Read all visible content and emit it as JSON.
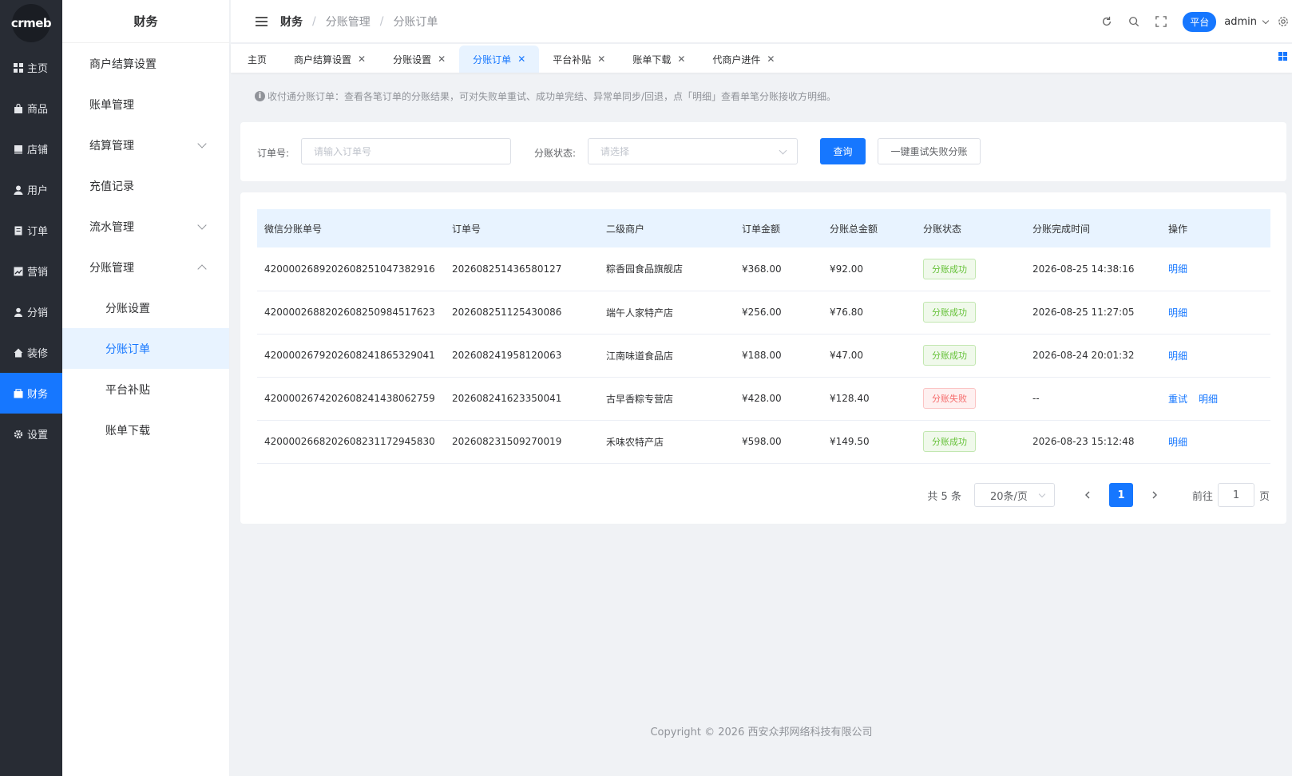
{
  "brand": {
    "logo_text": "crmeb"
  },
  "rail": [
    {
      "label": "主页",
      "icon": "grid-icon",
      "active": false
    },
    {
      "label": "商品",
      "icon": "bag-icon",
      "active": false
    },
    {
      "label": "店铺",
      "icon": "store-icon",
      "active": false
    },
    {
      "label": "用户",
      "icon": "user-icon",
      "active": false
    },
    {
      "label": "订单",
      "icon": "order-icon",
      "active": false
    },
    {
      "label": "营销",
      "icon": "chart-icon",
      "active": false
    },
    {
      "label": "分销",
      "icon": "distribution-icon",
      "active": false
    },
    {
      "label": "装修",
      "icon": "home-icon",
      "active": false
    },
    {
      "label": "财务",
      "icon": "finance-icon",
      "active": true
    },
    {
      "label": "设置",
      "icon": "gear-icon",
      "active": false
    }
  ],
  "sub_menu": {
    "title": "财务",
    "items": [
      {
        "label": "商户结算设置",
        "chevron": "",
        "child": false,
        "active": false
      },
      {
        "label": "账单管理",
        "chevron": "",
        "child": false,
        "active": false
      },
      {
        "label": "结算管理",
        "chevron": "down",
        "child": false,
        "active": false
      },
      {
        "label": "充值记录",
        "chevron": "",
        "child": false,
        "active": false
      },
      {
        "label": "流水管理",
        "chevron": "down",
        "child": false,
        "active": false
      },
      {
        "label": "分账管理",
        "chevron": "up",
        "child": false,
        "active": false
      },
      {
        "label": "分账设置",
        "chevron": "",
        "child": true,
        "active": false
      },
      {
        "label": "分账订单",
        "chevron": "",
        "child": true,
        "active": true
      },
      {
        "label": "平台补贴",
        "chevron": "",
        "child": true,
        "active": false
      },
      {
        "label": "账单下载",
        "chevron": "",
        "child": true,
        "active": false
      }
    ]
  },
  "header": {
    "breadcrumb": [
      "财务",
      "分账管理",
      "分账订单"
    ],
    "platform_badge": "平台",
    "user": "admin"
  },
  "tabs": [
    {
      "label": "主页",
      "closable": false,
      "active": false
    },
    {
      "label": "商户结算设置",
      "closable": true,
      "active": false
    },
    {
      "label": "分账设置",
      "closable": true,
      "active": false
    },
    {
      "label": "分账订单",
      "closable": true,
      "active": true
    },
    {
      "label": "平台补贴",
      "closable": true,
      "active": false
    },
    {
      "label": "账单下载",
      "closable": true,
      "active": false
    },
    {
      "label": "代商户进件",
      "closable": true,
      "active": false
    }
  ],
  "notice": "收付通分账订单：查看各笔订单的分账结果，可对失败单重试、成功单完结、异常单同步/回退，点「明细」查看单笔分账接收方明细。",
  "search": {
    "order_label": "订单号:",
    "order_placeholder": "请输入订单号",
    "status_label": "分账状态:",
    "status_placeholder": "请选择",
    "query_button": "查询",
    "retry_all_button": "一键重试失败分账"
  },
  "table": {
    "columns": [
      "微信分账单号",
      "订单号",
      "二级商户",
      "订单金额",
      "分账总金额",
      "分账状态",
      "分账完成时间",
      "操作"
    ],
    "rows": [
      {
        "wx_no": "4200002689202608251047382916",
        "order_no": "202608251436580127",
        "merchant": "粽香园食品旗舰店",
        "amount": "¥368.00",
        "split": "¥92.00",
        "status": "分账成功",
        "status_type": "ok",
        "time": "2026-08-25 14:38:16",
        "actions": [
          "明细"
        ]
      },
      {
        "wx_no": "4200002688202608250984517623",
        "order_no": "202608251125430086",
        "merchant": "端午人家特产店",
        "amount": "¥256.00",
        "split": "¥76.80",
        "status": "分账成功",
        "status_type": "ok",
        "time": "2026-08-25 11:27:05",
        "actions": [
          "明细"
        ]
      },
      {
        "wx_no": "4200002679202608241865329041",
        "order_no": "202608241958120063",
        "merchant": "江南味道食品店",
        "amount": "¥188.00",
        "split": "¥47.00",
        "status": "分账成功",
        "status_type": "ok",
        "time": "2026-08-24 20:01:32",
        "actions": [
          "明细"
        ]
      },
      {
        "wx_no": "4200002674202608241438062759",
        "order_no": "202608241623350041",
        "merchant": "古早香粽专营店",
        "amount": "¥428.00",
        "split": "¥128.40",
        "status": "分账失败",
        "status_type": "fail",
        "time": "--",
        "actions": [
          "重试",
          "明细"
        ]
      },
      {
        "wx_no": "4200002668202608231172945830",
        "order_no": "202608231509270019",
        "merchant": "禾味农特产店",
        "amount": "¥598.00",
        "split": "¥149.50",
        "status": "分账成功",
        "status_type": "ok",
        "time": "2026-08-23 15:12:48",
        "actions": [
          "明细"
        ]
      }
    ]
  },
  "pagination": {
    "total": "共 5 条",
    "page_size": "20条/页",
    "current": "1",
    "goto_label": "前往",
    "goto_value": "1",
    "goto_suffix": "页"
  },
  "footer": "Copyright © 2026 西安众邦网络科技有限公司",
  "colors": {
    "primary": "#1677ff",
    "rail_bg": "#282c34",
    "success": "#67c23a",
    "danger": "#f56c6c"
  }
}
